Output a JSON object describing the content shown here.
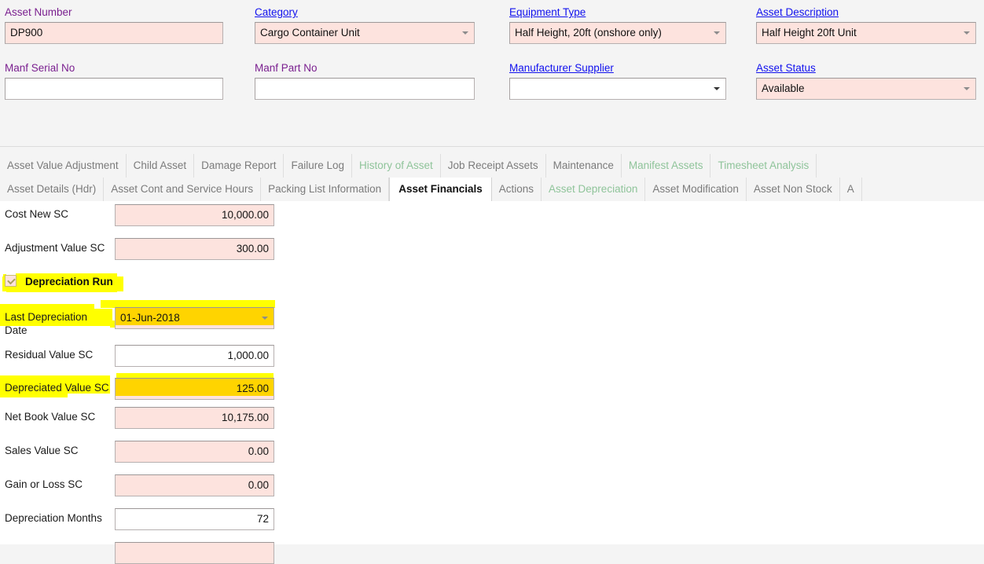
{
  "header": {
    "fields": [
      {
        "label": "Asset Number",
        "label_style": "purple",
        "value": "DP900",
        "control": "text",
        "filled": true
      },
      {
        "label": "Category",
        "label_style": "link",
        "value": "Cargo Container Unit",
        "control": "combo",
        "filled": true
      },
      {
        "label": "Equipment Type",
        "label_style": "link",
        "value": "Half Height, 20ft (onshore only)",
        "control": "combo",
        "filled": true
      },
      {
        "label": "Asset Description",
        "label_style": "link",
        "value": "Half Height 20ft Unit",
        "control": "combo",
        "filled": true
      },
      {
        "label": "Manf Serial No",
        "label_style": "purple",
        "value": "",
        "control": "text",
        "filled": false
      },
      {
        "label": "Manf Part No",
        "label_style": "purple",
        "value": "",
        "control": "text",
        "filled": false
      },
      {
        "label": "Manufacturer Supplier",
        "label_style": "link",
        "value": "",
        "control": "combo",
        "filled": false
      },
      {
        "label": "Asset Status",
        "label_style": "link",
        "value": "Available",
        "control": "combo",
        "filled": true
      }
    ]
  },
  "tabs": {
    "row1": [
      {
        "label": "Asset Value Adjustment",
        "state": "normal"
      },
      {
        "label": "Child Asset",
        "state": "normal"
      },
      {
        "label": "Damage Report",
        "state": "normal"
      },
      {
        "label": "Failure Log",
        "state": "normal"
      },
      {
        "label": "History of Asset",
        "state": "green"
      },
      {
        "label": "Job Receipt Assets",
        "state": "normal"
      },
      {
        "label": "Maintenance",
        "state": "normal"
      },
      {
        "label": "Manifest Assets",
        "state": "green"
      },
      {
        "label": "Timesheet Analysis",
        "state": "green"
      }
    ],
    "row2": [
      {
        "label": "Asset Details (Hdr)",
        "state": "normal"
      },
      {
        "label": "Asset Cont and Service Hours",
        "state": "normal"
      },
      {
        "label": "Packing List Information",
        "state": "normal"
      },
      {
        "label": "Asset Financials",
        "state": "active"
      },
      {
        "label": "Actions",
        "state": "normal"
      },
      {
        "label": "Asset Depreciation",
        "state": "green"
      },
      {
        "label": "Asset Modification",
        "state": "normal"
      },
      {
        "label": "Asset Non Stock",
        "state": "normal"
      },
      {
        "label": "A",
        "state": "normal"
      }
    ]
  },
  "financials": {
    "rows": [
      {
        "label": "Cost New SC",
        "value": "10,000.00",
        "style": "pink",
        "control": "text"
      },
      {
        "label": "Adjustment Value SC",
        "value": "300.00",
        "style": "pink",
        "control": "text"
      },
      {
        "label": "Last Depreciation Date",
        "value": "01-Jun-2018",
        "style": "gold",
        "control": "combo"
      },
      {
        "label": "Residual Value SC",
        "value": "1,000.00",
        "style": "white",
        "control": "text"
      },
      {
        "label": "Depreciated Value SC",
        "value": "125.00",
        "style": "gold",
        "control": "text"
      },
      {
        "label": "Net Book Value SC",
        "value": "10,175.00",
        "style": "pink",
        "control": "text"
      },
      {
        "label": "Sales Value SC",
        "value": "0.00",
        "style": "pink",
        "control": "text"
      },
      {
        "label": "Gain or Loss SC",
        "value": "0.00",
        "style": "pink",
        "control": "text"
      },
      {
        "label": "Depreciation Months",
        "value": "72",
        "style": "white",
        "control": "text"
      },
      {
        "label": "",
        "value": "",
        "style": "pink",
        "control": "text"
      }
    ],
    "checkbox": {
      "label": "Depreciation Run",
      "checked": true
    }
  }
}
